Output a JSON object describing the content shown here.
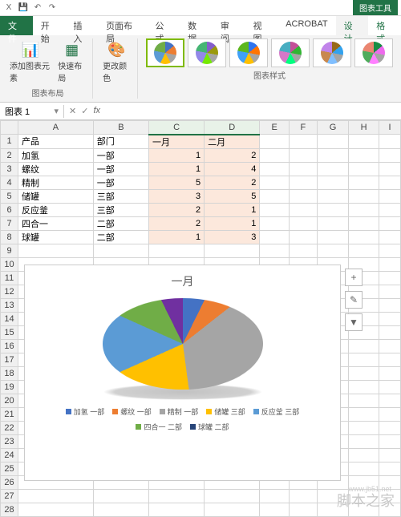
{
  "titlebar": {
    "chart_tools": "图表工具"
  },
  "tabs": {
    "file": "文件",
    "start": "开始",
    "insert": "插入",
    "layout": "页面布局",
    "formula": "公式",
    "data": "数据",
    "review": "审阅",
    "view": "视图",
    "acrobat": "ACROBAT",
    "design": "设计",
    "format": "格式"
  },
  "ribbon": {
    "add_element": "添加图表元素",
    "quick_layout": "快速布局",
    "change_colors": "更改颜色",
    "group_layout": "图表布局",
    "group_styles": "图表样式"
  },
  "namebox": "图表 1",
  "columns": [
    "A",
    "B",
    "C",
    "D",
    "E",
    "F",
    "G",
    "H",
    "I"
  ],
  "rows": [
    "1",
    "2",
    "3",
    "4",
    "5",
    "6",
    "7",
    "8",
    "9",
    "10",
    "11",
    "12",
    "13",
    "14",
    "15",
    "16",
    "17",
    "18",
    "19",
    "20",
    "21",
    "22",
    "23",
    "24",
    "25",
    "26",
    "27",
    "28"
  ],
  "headers": {
    "product": "产品",
    "dept": "部门",
    "m1": "一月",
    "m2": "二月"
  },
  "data": [
    {
      "p": "加氢",
      "d": "一部",
      "m1": "1",
      "m2": "2"
    },
    {
      "p": "螺纹",
      "d": "一部",
      "m1": "1",
      "m2": "4"
    },
    {
      "p": "精制",
      "d": "一部",
      "m1": "5",
      "m2": "2"
    },
    {
      "p": "储罐",
      "d": "三部",
      "m1": "3",
      "m2": "5"
    },
    {
      "p": "反应釜",
      "d": "三部",
      "m1": "2",
      "m2": "1"
    },
    {
      "p": "四合一",
      "d": "二部",
      "m1": "2",
      "m2": "1"
    },
    {
      "p": "球罐",
      "d": "二部",
      "m1": "1",
      "m2": "3"
    }
  ],
  "chart": {
    "title": "一月",
    "buttons": {
      "plus": "+",
      "brush": "✎",
      "filter": "▼"
    }
  },
  "chart_data": {
    "type": "pie",
    "title": "一月",
    "categories": [
      "加氢 一部",
      "螺纹 一部",
      "精制 一部",
      "储罐 三部",
      "反应釜 三部",
      "四合一 二部",
      "球罐 二部"
    ],
    "values": [
      1,
      1,
      5,
      3,
      2,
      2,
      1
    ],
    "colors": [
      "#4472c4",
      "#ed7d31",
      "#a5a5a5",
      "#ffc000",
      "#5b9bd5",
      "#70ad47",
      "#264478"
    ]
  },
  "watermark": {
    "text": "脚本之家",
    "url": "www.jb51.net"
  }
}
